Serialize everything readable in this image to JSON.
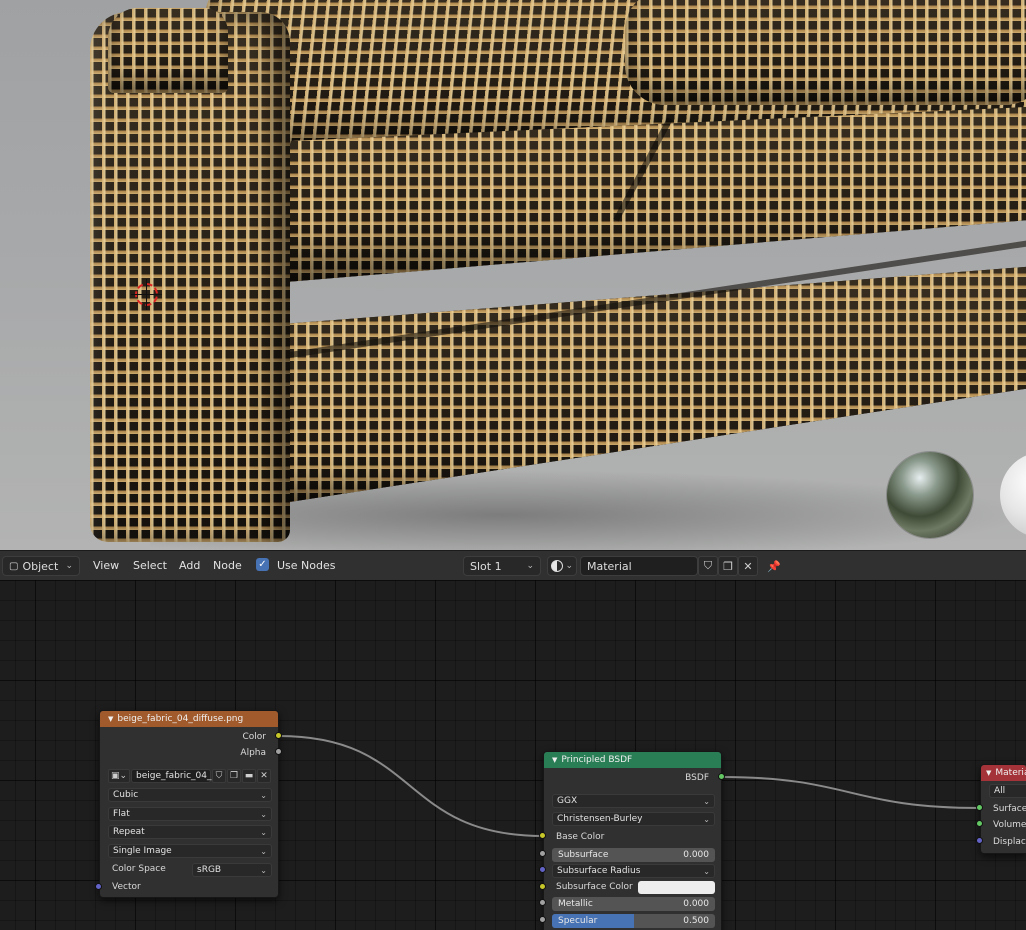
{
  "header": {
    "mode_select": "Object",
    "menus": [
      "View",
      "Select",
      "Add",
      "Node"
    ],
    "use_nodes_label": "Use Nodes",
    "use_nodes_checked": true,
    "slot_select": "Slot 1",
    "material_name": "Material",
    "icons": [
      "material-sphere-icon",
      "fake-user-shield-icon",
      "duplicate-icon",
      "close-icon",
      "pin-icon"
    ]
  },
  "image_node": {
    "title": "beige_fabric_04_diffuse.png",
    "outputs": [
      "Color",
      "Alpha"
    ],
    "image_name": "beige_fabric_04_...",
    "interpolation": "Cubic",
    "projection": "Flat",
    "extension": "Repeat",
    "source": "Single Image",
    "color_space_label": "Color Space",
    "color_space": "sRGB",
    "input_vector": "Vector",
    "header_color": "#a05a2c"
  },
  "bsdf_node": {
    "title": "Principled BSDF",
    "output": "BSDF",
    "distribution": "GGX",
    "subsurface_method": "Christensen-Burley",
    "base_color_label": "Base Color",
    "subsurface_label": "Subsurface",
    "subsurface_value": "0.000",
    "subsurface_radius_label": "Subsurface Radius",
    "subsurface_color_label": "Subsurface Color",
    "metallic_label": "Metallic",
    "metallic_value": "0.000",
    "specular_label": "Specular",
    "specular_value": "0.500",
    "specular_fraction": 0.5,
    "header_color": "#2a7e56"
  },
  "output_node": {
    "title": "Material Output",
    "target": "All",
    "inputs": [
      "Surface",
      "Volume",
      "Displacement"
    ],
    "header_color": "#a33338"
  }
}
